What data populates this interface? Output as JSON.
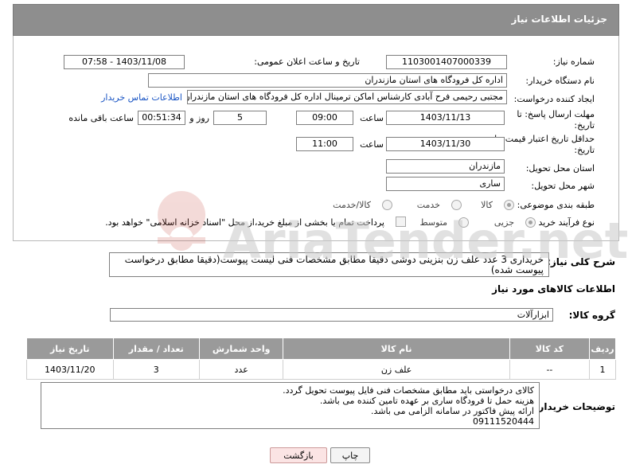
{
  "header": {
    "title": "جزئیات اطلاعات نیاز"
  },
  "form": {
    "need_number_label": "شماره نیاز:",
    "need_number": "1103001407000339",
    "announce_label": "تاریخ و ساعت اعلان عمومی:",
    "announce_value": "1403/11/08 - 07:58",
    "buyer_org_label": "نام دستگاه خریدار:",
    "buyer_org": "اداره کل فرودگاه های استان مازندران",
    "requester_label": "ایجاد کننده درخواست:",
    "requester": "مجتبی رحیمی فرح آبادی کارشناس اماکن ترمینال اداره کل فرودگاه های استان مازندران",
    "contact_link": "اطلاعات تماس خریدار",
    "deadline_label_1": "مهلت ارسال پاسخ: تا",
    "deadline_label_2": "تاریخ:",
    "deadline_date": "1403/11/13",
    "time_label": "ساعت",
    "deadline_time": "09:00",
    "days_value": "5",
    "days_label": "روز و",
    "remaining_value": "00:51:34",
    "remaining_label": "ساعت باقی مانده",
    "validity_label_1": "حداقل تاریخ اعتبار قیمت: تا",
    "validity_label_2": "تاریخ:",
    "validity_date": "1403/11/30",
    "validity_time_label": "ساعت",
    "validity_time": "11:00",
    "province_label": "استان محل تحویل:",
    "province": "مازندران",
    "city_label": "شهر محل تحویل:",
    "city": "ساری",
    "category_label": "طبقه بندی موضوعی:",
    "category_options": [
      "کالا",
      "خدمت",
      "کالا/خدمت"
    ],
    "category_selected": "کالا",
    "process_label": "نوع فرآیند خرید :",
    "process_options": [
      "جزیی",
      "متوسط"
    ],
    "process_selected": "جزیی",
    "payment_text": "پرداخت تمام یا بخشی از مبلغ خرید،از محل \"اسناد خزانه اسلامی\" خواهد بود."
  },
  "description": {
    "label": "شرح کلی نیاز:",
    "text": "خریداری 3 عدد علف زن بنزینی دوشی دقیقا مطابق مشخصات فنی لیست پیوست(دقیقا مطابق درخواست پیوست شده)"
  },
  "goods": {
    "section_title": "اطلاعات کالاهای مورد نیاز",
    "group_label": "گروه کالا:",
    "group_value": "ابزارآلات",
    "columns": [
      "ردیف",
      "کد کالا",
      "نام کالا",
      "واحد شمارش",
      "تعداد / مقدار",
      "تاریخ نیاز"
    ],
    "rows": [
      [
        "1",
        "--",
        "علف زن",
        "عدد",
        "3",
        "1403/11/20"
      ]
    ]
  },
  "buyer_notes": {
    "label": "توضیحات خریدار:",
    "lines": [
      "کالای درخواستی باید مطابق مشخصات فنی فایل پیوست تحویل گردد.",
      "هزینه حمل تا فرودگاه ساری بر عهده تامین کننده می باشد.",
      "ارائه پیش فاکتور در سامانه الزامی می باشد.",
      "09111520444"
    ]
  },
  "buttons": {
    "print": "چاپ",
    "back": "بازگشت"
  },
  "watermark": {
    "text": "AriaTender.net"
  }
}
